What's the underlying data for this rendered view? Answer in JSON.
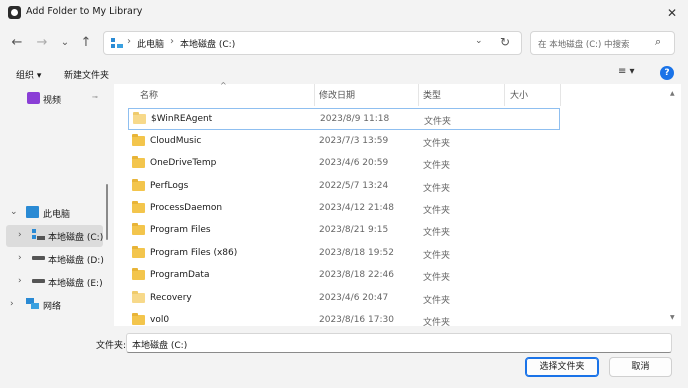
{
  "window": {
    "title": "Add Folder to My Library",
    "close": "✕"
  },
  "nav": {
    "back": "←",
    "forward": "→",
    "recent": "⌄",
    "up": "↑"
  },
  "address": {
    "segments": [
      "此电脑",
      "本地磁盘 (C:)"
    ],
    "separator": "›",
    "dropdown": "⌄",
    "refresh": "↻"
  },
  "search": {
    "placeholder": "在 本地磁盘 (C:) 中搜索",
    "icon": "⌕"
  },
  "toolbar": {
    "organize": "组织 ▾",
    "new_folder": "新建文件夹",
    "view": "≡ ▾",
    "help": "?"
  },
  "sidebar": {
    "items": [
      {
        "label": "视频",
        "icon": "video-icon",
        "chevron": "",
        "pin": "📌"
      },
      {
        "label": "此电脑",
        "icon": "computer-icon",
        "chevron": "⌄"
      },
      {
        "label": "本地磁盘 (C:)",
        "icon": "drive-c-icon",
        "chevron": "›",
        "selected": true
      },
      {
        "label": "本地磁盘 (D:)",
        "icon": "drive-icon",
        "chevron": "›"
      },
      {
        "label": "本地磁盘 (E:)",
        "icon": "drive-icon",
        "chevron": "›"
      },
      {
        "label": "网络",
        "icon": "network-icon",
        "chevron": "›"
      }
    ]
  },
  "columns": {
    "name": "名称",
    "modified": "修改日期",
    "type": "类型",
    "size": "大小",
    "sort_indicator": "^"
  },
  "files": [
    {
      "name": "$WinREAgent",
      "modified": "2023/8/9 11:18",
      "type": "文件夹"
    },
    {
      "name": "CloudMusic",
      "modified": "2023/7/3 13:59",
      "type": "文件夹"
    },
    {
      "name": "OneDriveTemp",
      "modified": "2023/4/6 20:59",
      "type": "文件夹"
    },
    {
      "name": "PerfLogs",
      "modified": "2022/5/7 13:24",
      "type": "文件夹"
    },
    {
      "name": "ProcessDaemon",
      "modified": "2023/4/12 21:48",
      "type": "文件夹"
    },
    {
      "name": "Program Files",
      "modified": "2023/8/21 9:15",
      "type": "文件夹"
    },
    {
      "name": "Program Files (x86)",
      "modified": "2023/8/18 19:52",
      "type": "文件夹"
    },
    {
      "name": "ProgramData",
      "modified": "2023/8/18 22:46",
      "type": "文件夹"
    },
    {
      "name": "Recovery",
      "modified": "2023/4/6 20:47",
      "type": "文件夹"
    },
    {
      "name": "vol0",
      "modified": "2023/8/16 17:30",
      "type": "文件夹"
    }
  ],
  "footer": {
    "filename_label": "文件夹:",
    "filename_value": "本地磁盘 (C:)",
    "select_button": "选择文件夹",
    "cancel_button": "取消"
  },
  "colors": {
    "accent": "#1a73e8",
    "folder": "#f3c54c",
    "selection": "#dcdcdc"
  }
}
